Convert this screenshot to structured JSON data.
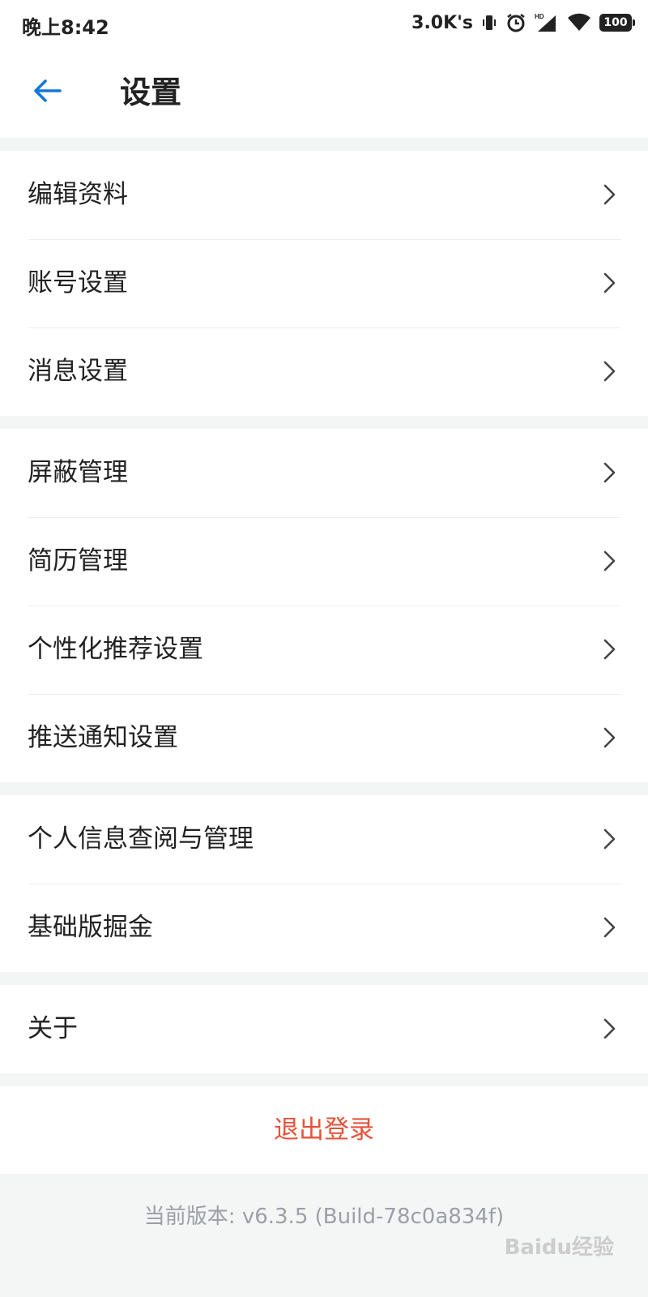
{
  "status_bar": {
    "time": "晚上8:42",
    "net_speed": "3.0K's",
    "battery": "100"
  },
  "header": {
    "title": "设置",
    "back_icon": "arrow-left-icon",
    "accent_color": "#1677d9"
  },
  "menu_groups": [
    {
      "items": [
        {
          "label": "编辑资料"
        },
        {
          "label": "账号设置"
        },
        {
          "label": "消息设置"
        }
      ]
    },
    {
      "items": [
        {
          "label": "屏蔽管理"
        },
        {
          "label": "简历管理"
        },
        {
          "label": "个性化推荐设置"
        },
        {
          "label": "推送通知设置"
        }
      ]
    },
    {
      "items": [
        {
          "label": "个人信息查阅与管理"
        },
        {
          "label": "基础版掘金"
        }
      ]
    },
    {
      "items": [
        {
          "label": "关于"
        }
      ]
    }
  ],
  "logout": {
    "label": "退出登录",
    "color": "#e5533a"
  },
  "version_text": "当前版本: v6.3.5 (Build-78c0a834f)",
  "watermark": "Baidu经验"
}
